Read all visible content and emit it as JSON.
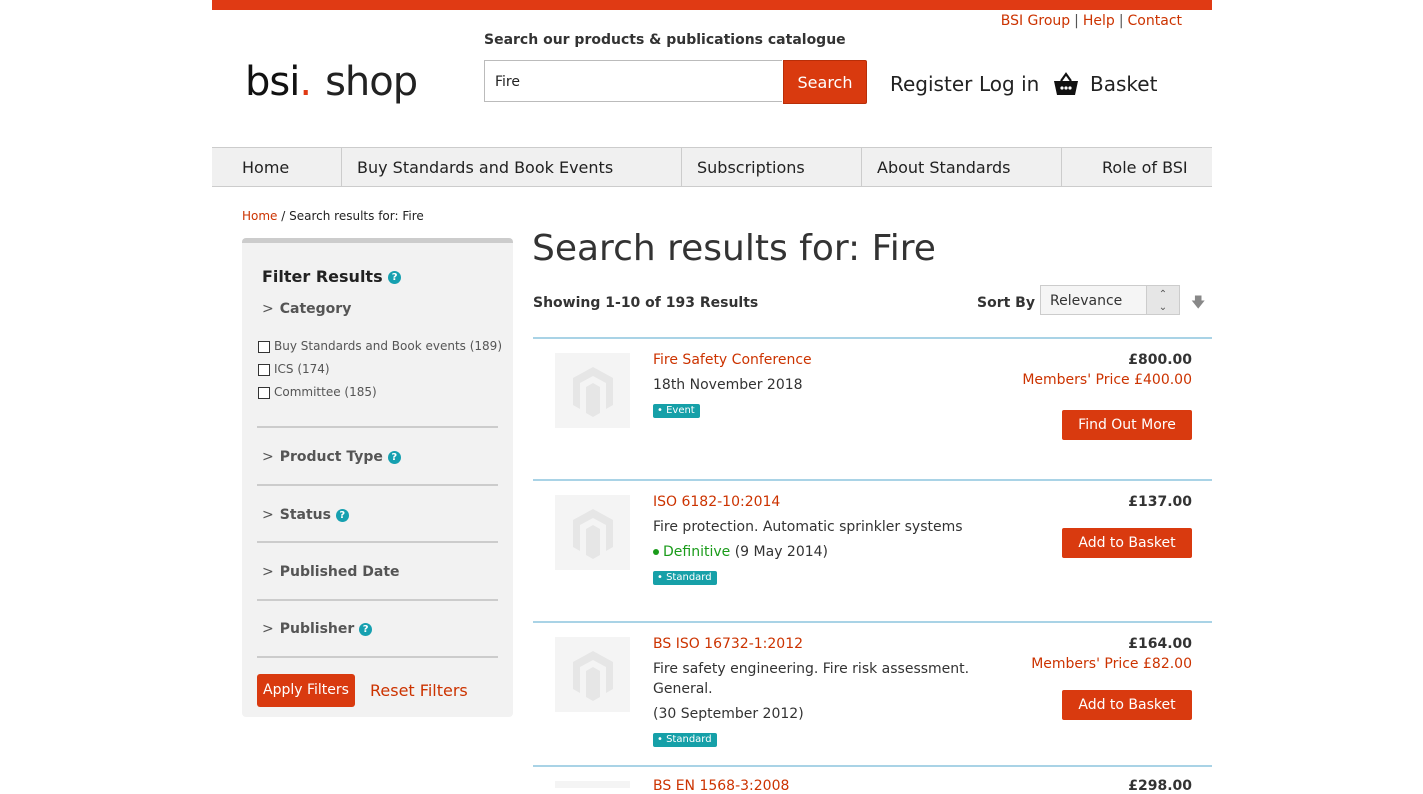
{
  "top_links": [
    "BSI Group",
    "Help",
    "Contact"
  ],
  "logo": {
    "bsi": "bsi",
    "dot": ".",
    "shop": "shop"
  },
  "search": {
    "heading": "Search our products & publications catalogue",
    "value": "Fire",
    "button": "Search"
  },
  "account": {
    "register": "Register",
    "login": "Log in",
    "basket": "Basket"
  },
  "nav": [
    "Home",
    "Buy Standards and Book Events",
    "Subscriptions",
    "About Standards",
    "Role of BSI"
  ],
  "breadcrumb": {
    "home": "Home",
    "sep": "/",
    "current": "Search results for: Fire"
  },
  "filter": {
    "title": "Filter Results",
    "category_label": "Category",
    "categories": [
      "Buy Standards and Book events (189)",
      "ICS (174)",
      "Committee (185)"
    ],
    "sections": [
      "Product Type",
      "Status",
      "Published Date",
      "Publisher"
    ],
    "apply": "Apply Filters",
    "reset": "Reset Filters",
    "chevron": ">",
    "help_glyph": "?"
  },
  "results": {
    "title": "Search results for: Fire",
    "showing": "Showing 1-10 of 193 Results",
    "sort_label": "Sort By",
    "sort_value": "Relevance",
    "items": [
      {
        "title": "Fire Safety Conference",
        "line1": "18th November 2018",
        "tag": "Event",
        "price": "£800.00",
        "member_price": "Members' Price £400.00",
        "button": "Find Out More"
      },
      {
        "title": "ISO 6182-10:2014",
        "line1": "Fire protection. Automatic sprinkler systems",
        "status": "Definitive",
        "status_date": "(9 May 2014)",
        "tag": "Standard",
        "price": "£137.00",
        "button": "Add to Basket"
      },
      {
        "title": "BS ISO 16732-1:2012",
        "line1": "Fire safety engineering. Fire risk assessment.",
        "line2": "General.",
        "line3": "(30 September 2012)",
        "tag": "Standard",
        "price": "£164.00",
        "member_price": "Members' Price £82.00",
        "button": "Add to Basket"
      },
      {
        "title": "BS EN 1568-3:2008",
        "price": "£298.00"
      }
    ]
  },
  "colors": {
    "brand": "#e03a14",
    "button": "#d93a0f",
    "link": "#cc3300",
    "tag": "#16a0a8",
    "divider": "#a9d3e6"
  }
}
